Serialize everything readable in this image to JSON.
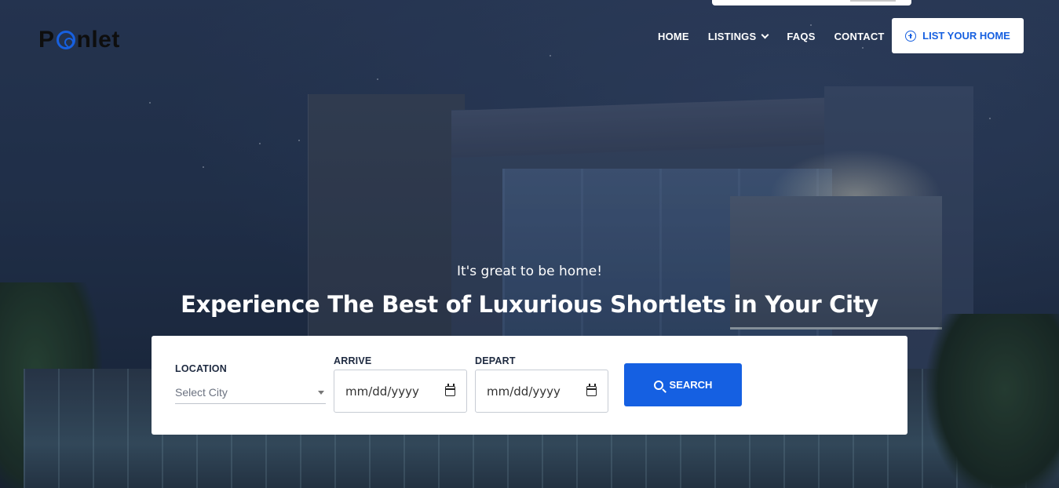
{
  "brand": {
    "logo_text_left": "P",
    "logo_text_right": "nlet",
    "accent": "#1760e0"
  },
  "nav": {
    "items": [
      {
        "label": "HOME"
      },
      {
        "label": "LISTINGS",
        "has_dropdown": true
      },
      {
        "label": "FAQS"
      },
      {
        "label": "CONTACT"
      }
    ],
    "cta_label": "LIST YOUR HOME",
    "cta_icon": "plus-circle-icon"
  },
  "hero": {
    "tagline": "It's great to be home!",
    "headline": "Experience The Best of Luxurious Shortlets in Your City"
  },
  "search": {
    "location_label": "LOCATION",
    "location_value": "Select City",
    "arrive_label": "ARRIVE",
    "arrive_value": "mm/dd/yyyy",
    "depart_label": "DEPART",
    "depart_value": "mm/dd/yyyy",
    "button_label": "SEARCH",
    "button_color": "#1560e2"
  }
}
